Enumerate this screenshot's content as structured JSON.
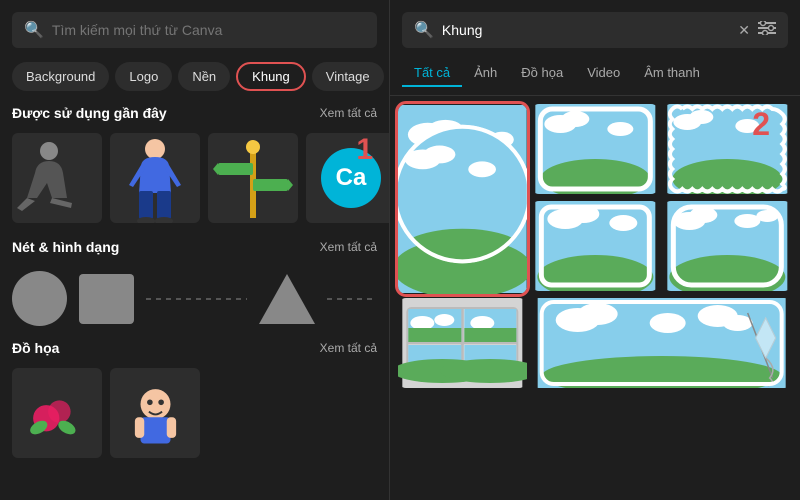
{
  "left": {
    "search_placeholder": "Tìm kiếm mọi thứ từ Canva",
    "categories": [
      {
        "label": "Background",
        "active": false
      },
      {
        "label": "Logo",
        "active": false
      },
      {
        "label": "Nền",
        "active": false
      },
      {
        "label": "Khung",
        "active": true
      },
      {
        "label": "Vintage",
        "active": false
      }
    ],
    "recently_used": {
      "title": "Được sử dụng gần đây",
      "link": "Xem tất cả"
    },
    "step_number": "1",
    "shapes_section": {
      "title": "Nét & hình dạng",
      "link": "Xem tất cả"
    },
    "dohoa_section": {
      "title": "Đồ họa",
      "link": "Xem tất cả"
    }
  },
  "right": {
    "search_value": "Khung",
    "tabs": [
      {
        "label": "Tất cả",
        "active": true
      },
      {
        "label": "Ảnh",
        "active": false
      },
      {
        "label": "Đồ họa",
        "active": false
      },
      {
        "label": "Video",
        "active": false
      },
      {
        "label": "Âm thanh",
        "active": false
      }
    ],
    "step_number": "2",
    "clear_icon": "✕",
    "filter_icon": "≡"
  }
}
